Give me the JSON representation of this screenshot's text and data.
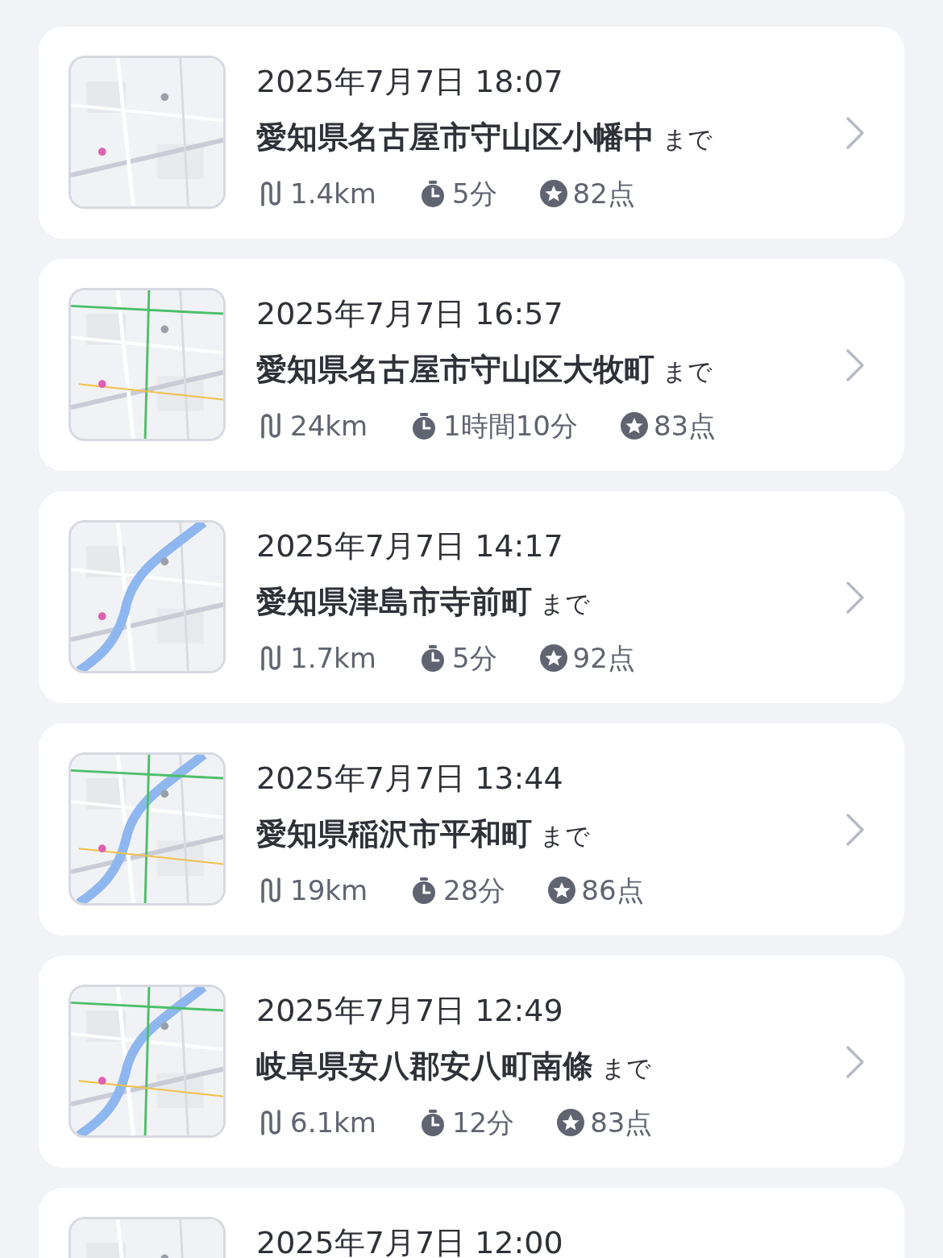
{
  "trips": [
    {
      "date": "2025年7月7日 18:07",
      "destination": "愛知県名古屋市守山区小幡中",
      "suffix": "まで",
      "distance": "1.4km",
      "duration": "5分",
      "score": "82点"
    },
    {
      "date": "2025年7月7日 16:57",
      "destination": "愛知県名古屋市守山区大牧町",
      "suffix": "まで",
      "distance": "24km",
      "duration": "1時間10分",
      "score": "83点"
    },
    {
      "date": "2025年7月7日 14:17",
      "destination": "愛知県津島市寺前町",
      "suffix": "まで",
      "distance": "1.7km",
      "duration": "5分",
      "score": "92点"
    },
    {
      "date": "2025年7月7日 13:44",
      "destination": "愛知県稲沢市平和町",
      "suffix": "まで",
      "distance": "19km",
      "duration": "28分",
      "score": "86点"
    },
    {
      "date": "2025年7月7日 12:49",
      "destination": "岐阜県安八郡安八町南條",
      "suffix": "まで",
      "distance": "6.1km",
      "duration": "12分",
      "score": "83点"
    },
    {
      "date": "2025年7月7日 12:00"
    }
  ]
}
